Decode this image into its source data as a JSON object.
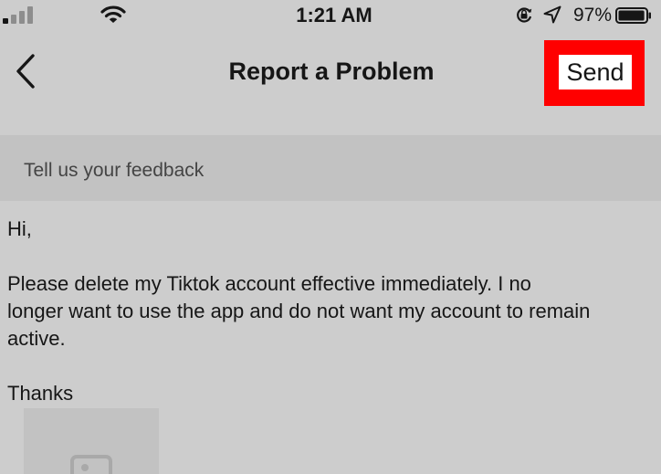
{
  "status_bar": {
    "time": "1:21 AM",
    "battery_percent": "97%",
    "battery_level": 0.97,
    "icons": [
      "signal-icon",
      "wifi-icon",
      "rotation-lock-icon",
      "location-arrow-icon",
      "battery-icon"
    ]
  },
  "nav": {
    "back_icon": "chevron-left-icon",
    "title": "Report a Problem",
    "send_label": "Send",
    "highlight_color": "#ff0000"
  },
  "feedback": {
    "label": "Tell us your feedback"
  },
  "message": {
    "lines": [
      "Hi,",
      "",
      "Please delete my Tiktok account effective immediately. I no",
      "longer want to use the app and do not want my account to remain",
      "active.",
      "",
      "Thanks"
    ]
  },
  "attachment": {
    "icon": "image-icon"
  }
}
